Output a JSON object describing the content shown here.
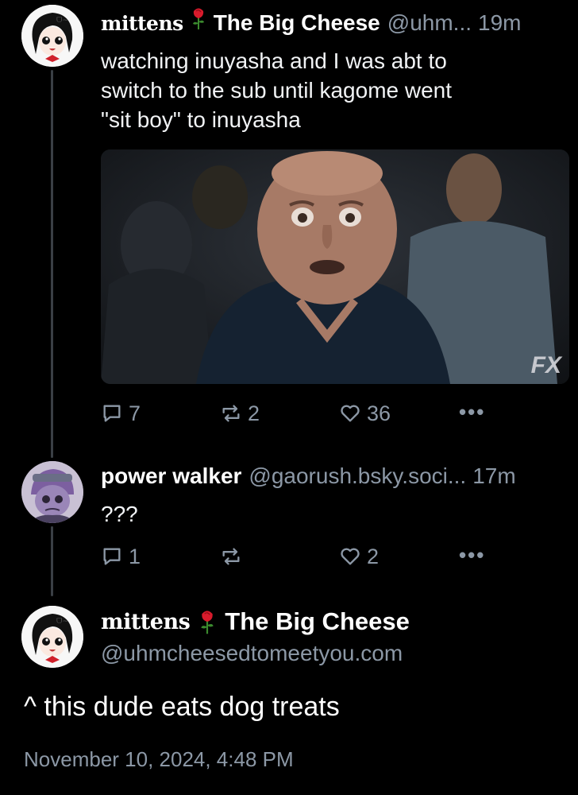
{
  "reply1": {
    "author_name": "mittens",
    "display_name": "The Big Cheese",
    "handle": "@uhm...",
    "time": "19m",
    "text_lines": [
      "watching inuyasha and I was abt to",
      "switch to the sub until kagome went",
      "\"sit boy\" to inuyasha"
    ],
    "media_watermark": "FX",
    "replies": "7",
    "reposts": "2",
    "likes": "36"
  },
  "reply2": {
    "display_name": "power walker",
    "handle": "@gaorush.bsky.soci...",
    "time": "17m",
    "text": "???",
    "replies": "1",
    "reposts": "",
    "likes": "2"
  },
  "main": {
    "author_name": "mittens",
    "display_name": "The Big Cheese",
    "handle": "@uhmcheesedtomeetyou.com",
    "text": "^ this dude eats dog treats",
    "timestamp": "November 10, 2024, 4:48 PM"
  },
  "icons": {
    "reply": "speech-bubble-icon",
    "repost": "repost-arrows-icon",
    "like": "heart-icon",
    "more": "ellipsis-icon",
    "rose": "rose-emoji-icon"
  },
  "colors": {
    "background": "#000000",
    "muted": "#8c98a6",
    "text": "#f1f3f5",
    "thread_line": "#3a3f45"
  }
}
